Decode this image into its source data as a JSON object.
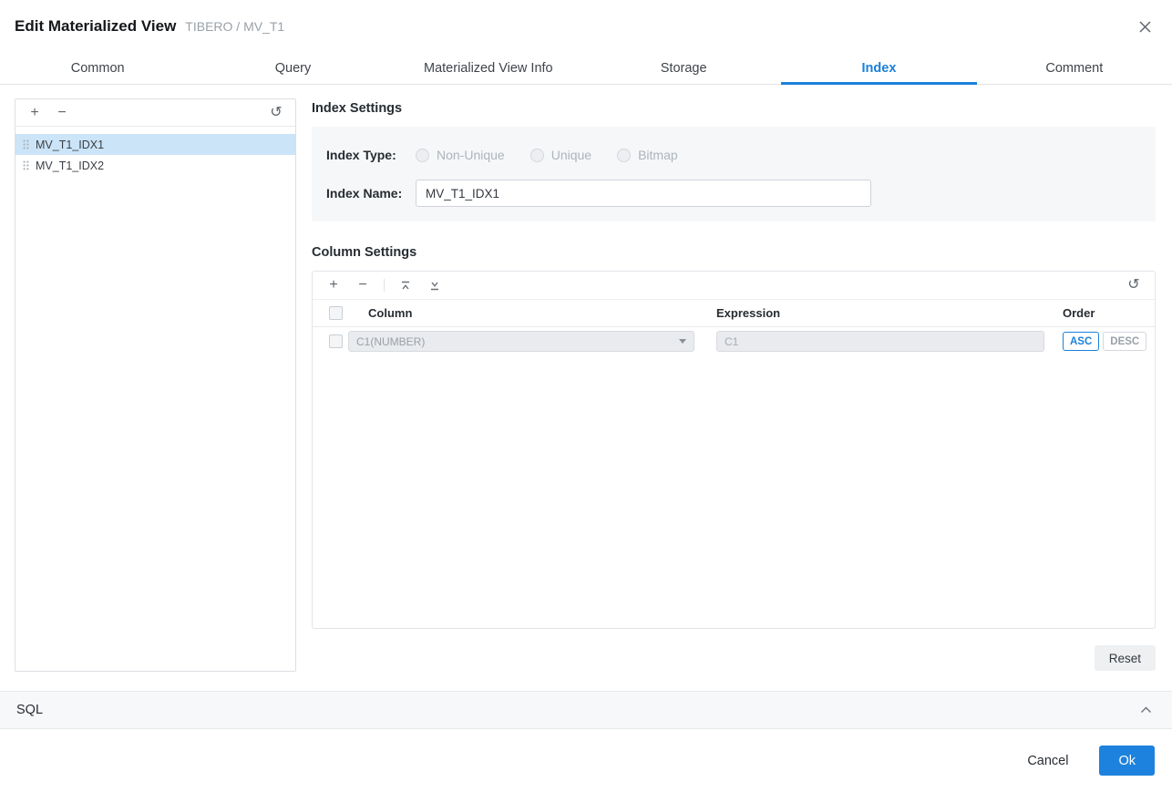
{
  "dialog": {
    "title": "Edit Materialized View",
    "subtitle": "TIBERO / MV_T1"
  },
  "tabs": [
    {
      "label": "Common",
      "active": false
    },
    {
      "label": "Query",
      "active": false
    },
    {
      "label": "Materialized View Info",
      "active": false
    },
    {
      "label": "Storage",
      "active": false
    },
    {
      "label": "Index",
      "active": true
    },
    {
      "label": "Comment",
      "active": false
    }
  ],
  "index_list": {
    "items": [
      {
        "name": "MV_T1_IDX1",
        "selected": true
      },
      {
        "name": "MV_T1_IDX2",
        "selected": false
      }
    ]
  },
  "index_settings": {
    "heading": "Index Settings",
    "index_type_label": "Index Type:",
    "index_type_options": [
      "Non-Unique",
      "Unique",
      "Bitmap"
    ],
    "index_name_label": "Index Name:",
    "index_name_value": "MV_T1_IDX1"
  },
  "column_settings": {
    "heading": "Column Settings",
    "table": {
      "headers": [
        "Column",
        "Expression",
        "Order"
      ],
      "rows": [
        {
          "column": "C1(NUMBER)",
          "expression": "C1",
          "order": "ASC"
        }
      ]
    },
    "order_options": [
      "ASC",
      "DESC"
    ]
  },
  "reset_button": "Reset",
  "sql_section": {
    "label": "SQL"
  },
  "footer": {
    "cancel": "Cancel",
    "ok": "Ok"
  },
  "icons": {
    "add": "+",
    "remove": "−",
    "refresh": "↺"
  },
  "colors": {
    "accent": "#1b80d9",
    "selected_item_bg": "#cce4f7",
    "ok_button_bg": "#1d82dd"
  }
}
